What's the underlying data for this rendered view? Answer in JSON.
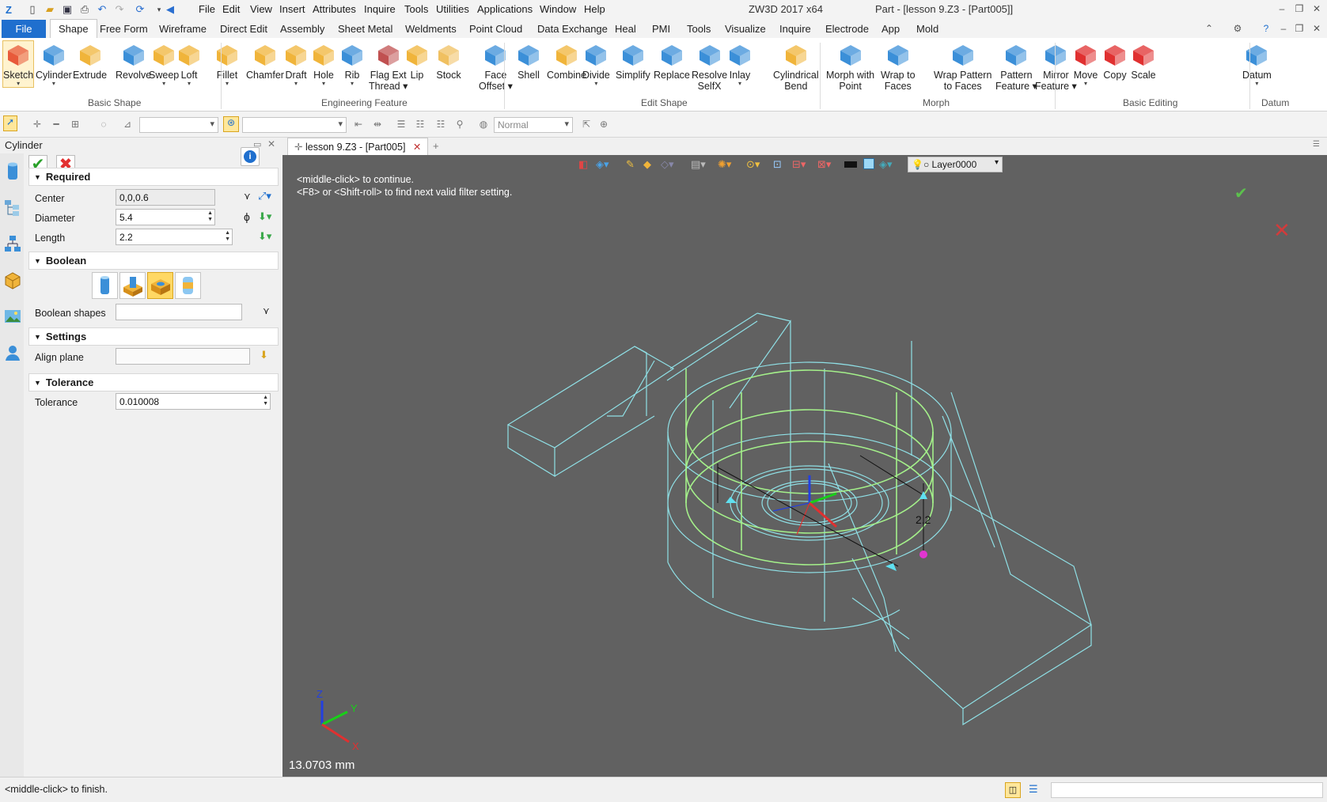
{
  "titlebar": {
    "menus": [
      "File",
      "Edit",
      "View",
      "Insert",
      "Attributes",
      "Inquire",
      "Tools",
      "Utilities",
      "Applications",
      "Window",
      "Help"
    ],
    "app": "ZW3D 2017  x64",
    "doc": "Part - [lesson 9.Z3 - [Part005]]"
  },
  "ribbon_tabs": {
    "file": "File",
    "tabs": [
      "Shape",
      "Free Form",
      "Wireframe",
      "Direct Edit",
      "Assembly",
      "Sheet Metal",
      "Weldments",
      "Point Cloud",
      "Data Exchange",
      "Heal",
      "PMI",
      "Tools",
      "Visualize",
      "Inquire",
      "Electrode",
      "App",
      "Mold"
    ],
    "active": "Shape"
  },
  "ribbon": {
    "buttons": [
      {
        "l1": "Sketch",
        "l2": "",
        "dd": true
      },
      {
        "l1": "Cylinder",
        "l2": "",
        "dd": true
      },
      {
        "l1": "Extrude",
        "l2": "",
        "dd": false
      },
      {
        "l1": "Revolve",
        "l2": "",
        "dd": false
      },
      {
        "l1": "Sweep",
        "l2": "",
        "dd": true
      },
      {
        "l1": "Loft",
        "l2": "",
        "dd": true
      },
      {
        "l1": "Fillet",
        "l2": "",
        "dd": true
      },
      {
        "l1": "Chamfer",
        "l2": "",
        "dd": false
      },
      {
        "l1": "Draft",
        "l2": "",
        "dd": true
      },
      {
        "l1": "Hole",
        "l2": "",
        "dd": true
      },
      {
        "l1": "Rib",
        "l2": "",
        "dd": true
      },
      {
        "l1": "Flag Ext",
        "l2": "Thread ▾",
        "dd": false
      },
      {
        "l1": "Lip",
        "l2": "",
        "dd": false
      },
      {
        "l1": "Stock",
        "l2": "",
        "dd": false
      },
      {
        "l1": "Face",
        "l2": "Offset ▾",
        "dd": false
      },
      {
        "l1": "Shell",
        "l2": "",
        "dd": false
      },
      {
        "l1": "Combine",
        "l2": "",
        "dd": false
      },
      {
        "l1": "Divide",
        "l2": "",
        "dd": true
      },
      {
        "l1": "Simplify",
        "l2": "",
        "dd": false
      },
      {
        "l1": "Replace",
        "l2": "",
        "dd": false
      },
      {
        "l1": "Resolve",
        "l2": "SelfX",
        "dd": false
      },
      {
        "l1": "Inlay",
        "l2": "",
        "dd": true
      },
      {
        "l1": "Cylindrical",
        "l2": "Bend",
        "dd": false
      },
      {
        "l1": "Morph with",
        "l2": "Point",
        "dd": false
      },
      {
        "l1": "Wrap to",
        "l2": "Faces",
        "dd": false
      },
      {
        "l1": "Wrap Pattern",
        "l2": "to Faces",
        "dd": false
      },
      {
        "l1": "Pattern",
        "l2": "Feature ▾",
        "dd": false
      },
      {
        "l1": "Mirror",
        "l2": "Feature ▾",
        "dd": false
      },
      {
        "l1": "Move",
        "l2": "",
        "dd": true
      },
      {
        "l1": "Copy",
        "l2": "",
        "dd": false
      },
      {
        "l1": "Scale",
        "l2": "",
        "dd": false
      },
      {
        "l1": "Datum",
        "l2": "",
        "dd": true
      }
    ],
    "groups": [
      "Basic Shape",
      "Engineering Feature",
      "Edit Shape",
      "Morph",
      "Basic Editing",
      "Datum"
    ]
  },
  "toolbar": {
    "render_mode": "Normal"
  },
  "panel": {
    "title": "Cylinder",
    "sections": {
      "required": "Required",
      "boolean": "Boolean",
      "settings": "Settings",
      "tolerance": "Tolerance"
    },
    "fields": {
      "center_label": "Center",
      "center_value": "0,0,0.6",
      "diameter_label": "Diameter",
      "diameter_value": "5.4",
      "length_label": "Length",
      "length_value": "2.2",
      "boolean_shapes_label": "Boolean shapes",
      "boolean_shapes_value": "",
      "align_plane_label": "Align plane",
      "align_plane_value": "",
      "tolerance_label": "Tolerance",
      "tolerance_value": "0.010008"
    }
  },
  "viewport": {
    "tab": "lesson 9.Z3 - [Part005]",
    "layer": "Layer0000",
    "msg1": "<middle-click> to continue.",
    "msg2": "<F8> or <Shift-roll> to find next valid filter setting.",
    "dim_label": "2.2",
    "distance": "13.0703 mm",
    "axis": {
      "x": "X",
      "y": "Y",
      "z": "Z"
    }
  },
  "status": {
    "text": "<middle-click> to finish."
  },
  "colors": {
    "accent": "#1f6fce",
    "wire": "#8fe0e6",
    "preview": "#a4f08a",
    "viewport_bg": "#616161"
  }
}
